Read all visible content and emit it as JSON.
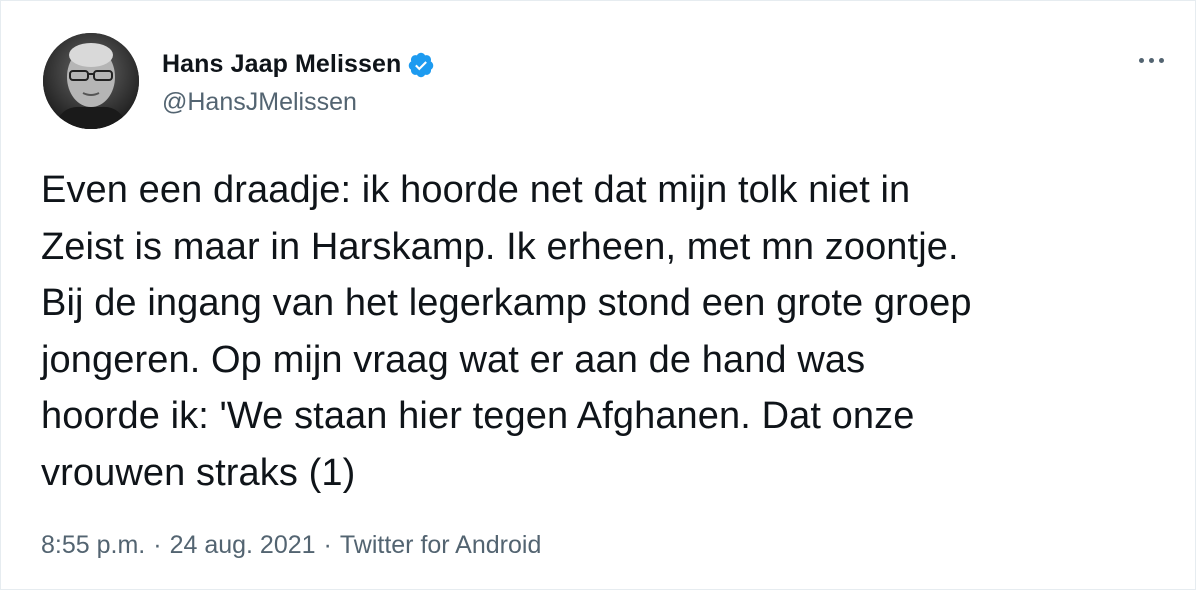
{
  "author": {
    "display_name": "Hans Jaap Melissen",
    "handle": "@HansJMelissen",
    "verified": true,
    "verified_color": "#1d9bf0"
  },
  "menu": {
    "icon": "more-horizontal-icon"
  },
  "tweet": {
    "text": "Even een draadje: ik hoorde net dat mijn tolk niet in\nZeist is maar in Harskamp. Ik erheen, met mn zoontje.\nBij de ingang van het legerkamp stond een grote groep\njongeren. Op mijn vraag wat er aan de hand was\nhoorde ik: 'We staan hier tegen Afghanen. Dat onze\nvrouwen straks (1)"
  },
  "meta": {
    "time": "8:55 p.m.",
    "separator": "·",
    "date": "24 aug. 2021",
    "source": "Twitter for Android"
  }
}
